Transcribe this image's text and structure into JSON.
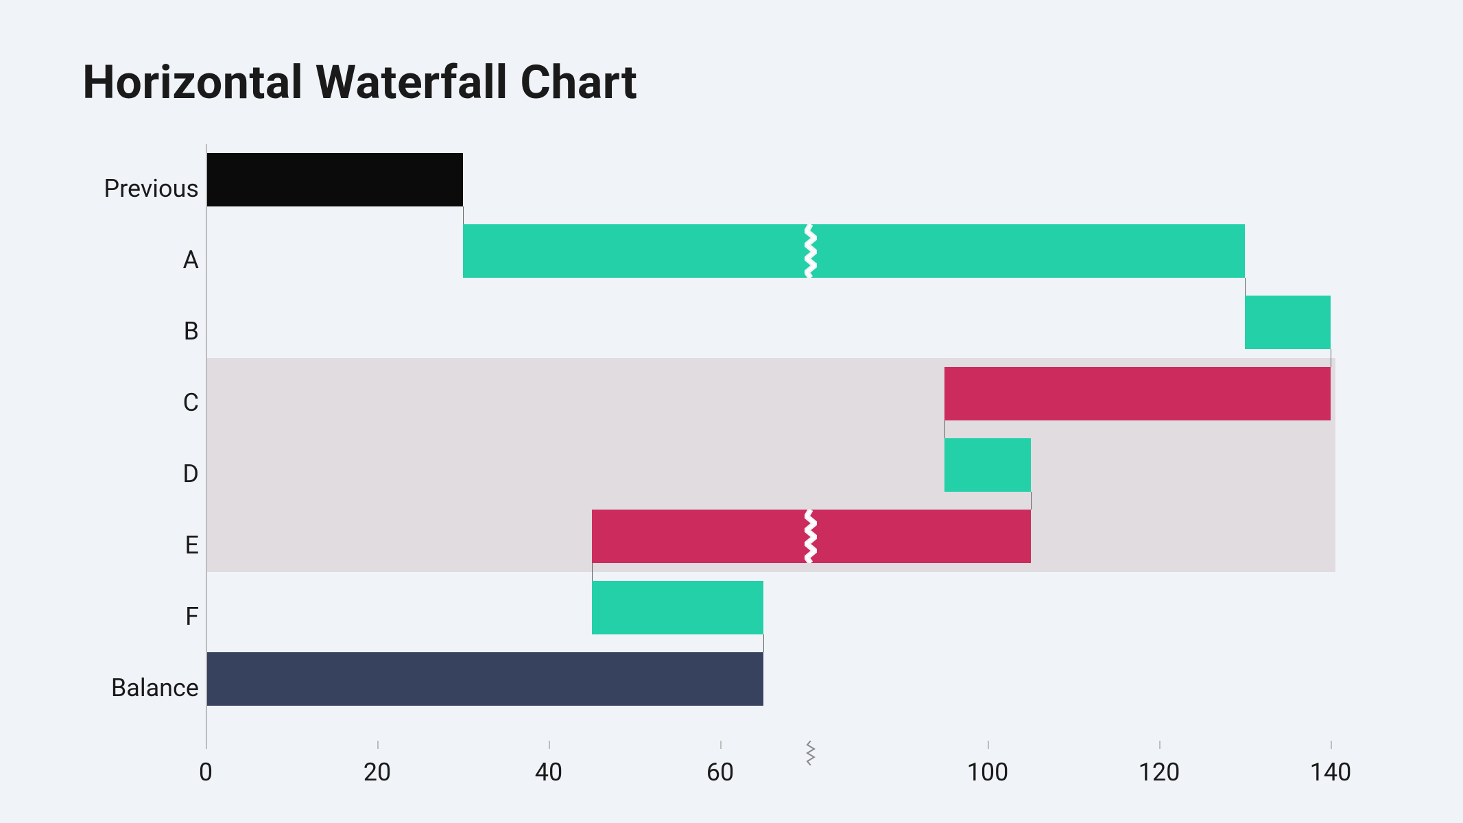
{
  "chart_data": {
    "type": "bar",
    "orientation": "horizontal",
    "subtype": "waterfall",
    "title": "Horizontal Waterfall Chart",
    "categories": [
      "Previous",
      "A",
      "B",
      "C",
      "D",
      "E",
      "F",
      "Balance"
    ],
    "x_ticks": [
      0,
      20,
      40,
      60,
      100,
      120,
      140
    ],
    "axis_break_between": [
      60,
      100
    ],
    "bars": [
      {
        "label": "Previous",
        "start": 0,
        "end": 30,
        "type": "total",
        "color": "#0b0b0b"
      },
      {
        "label": "A",
        "start": 30,
        "end": 130,
        "type": "increase",
        "color": "#23d0a8",
        "has_break": true
      },
      {
        "label": "B",
        "start": 130,
        "end": 140,
        "type": "increase",
        "color": "#23d0a8"
      },
      {
        "label": "C",
        "start": 140,
        "end": 95,
        "type": "decrease",
        "color": "#cc2b5e"
      },
      {
        "label": "D",
        "start": 95,
        "end": 105,
        "type": "increase",
        "color": "#23d0a8"
      },
      {
        "label": "E",
        "start": 105,
        "end": 45,
        "type": "decrease",
        "color": "#cc2b5e",
        "has_break": true
      },
      {
        "label": "F",
        "start": 45,
        "end": 65,
        "type": "increase",
        "color": "#23d0a8"
      },
      {
        "label": "Balance",
        "start": 0,
        "end": 65,
        "type": "total",
        "color": "#37425f"
      }
    ],
    "shading_rows": [
      "C",
      "D",
      "E"
    ],
    "colors": {
      "increase": "#23d0a8",
      "decrease": "#cc2b5e",
      "total_start": "#0b0b0b",
      "total_end": "#37425f",
      "shade": "#e0dcdf"
    }
  },
  "title": "Horizontal Waterfall Chart",
  "y_labels": {
    "0": "Previous",
    "1": "A",
    "2": "B",
    "3": "C",
    "4": "D",
    "5": "E",
    "6": "F",
    "7": "Balance"
  },
  "x_labels": {
    "0": "0",
    "1": "20",
    "2": "40",
    "3": "60",
    "4": "100",
    "5": "120",
    "6": "140"
  }
}
